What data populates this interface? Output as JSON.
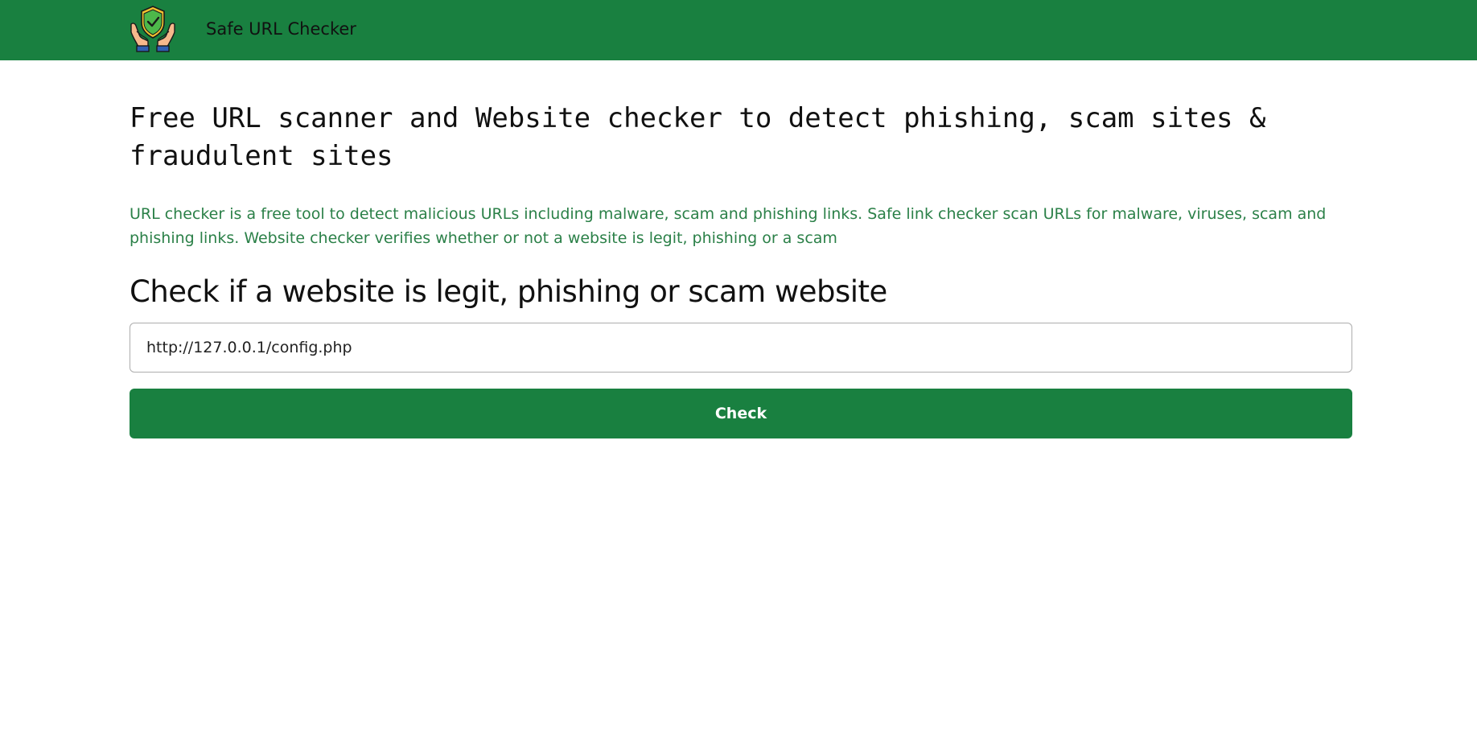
{
  "brand": {
    "name": "Safe URL Checker",
    "logo_icon": "shield-hands-icon",
    "colors": {
      "primary": "#198040",
      "description_text": "#2b8048"
    }
  },
  "hero": {
    "title": "Free URL scanner and Website checker to detect phishing, scam sites & fraudulent sites",
    "description": "URL checker is a free tool to detect malicious URLs including malware, scam and phishing links. Safe link checker scan URLs for malware, viruses, scam and phishing links. Website checker verifies whether or not a website is legit, phishing or a scam"
  },
  "checker": {
    "heading": "Check if a website is legit, phishing or scam website",
    "url_value": "http://127.0.0.1/config.php",
    "button_label": "Check"
  }
}
